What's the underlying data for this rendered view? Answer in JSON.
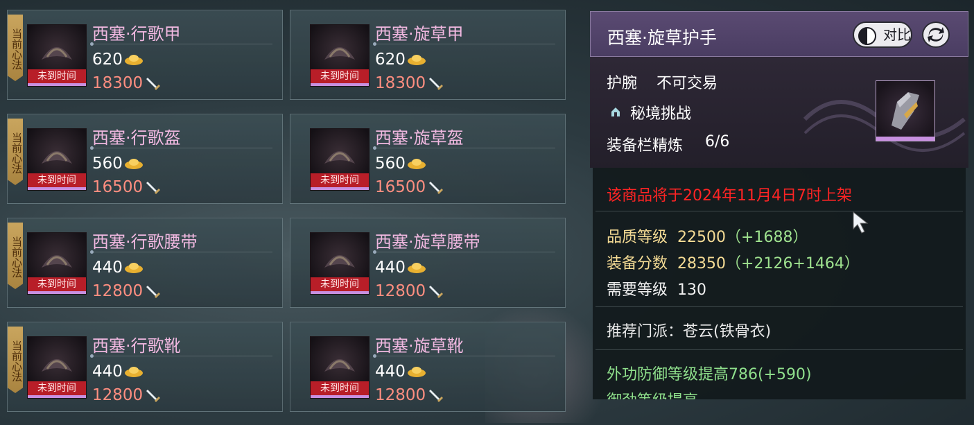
{
  "items": [
    {
      "badge": "当前心法",
      "name": "西塞·行歌甲",
      "price": "620",
      "cost": "18300",
      "timer": "未到时间"
    },
    {
      "badge": "",
      "name": "西塞·旋草甲",
      "price": "620",
      "cost": "18300",
      "timer": "未到时间"
    },
    {
      "badge": "当前心法",
      "name": "西塞·行歌盔",
      "price": "560",
      "cost": "16500",
      "timer": "未到时间"
    },
    {
      "badge": "",
      "name": "西塞·旋草盔",
      "price": "560",
      "cost": "16500",
      "timer": "未到时间"
    },
    {
      "badge": "当前心法",
      "name": "西塞·行歌腰带",
      "price": "440",
      "cost": "12800",
      "timer": "未到时间"
    },
    {
      "badge": "",
      "name": "西塞·旋草腰带",
      "price": "440",
      "cost": "12800",
      "timer": "未到时间"
    },
    {
      "badge": "当前心法",
      "name": "西塞·行歌靴",
      "price": "440",
      "cost": "12800",
      "timer": "未到时间"
    },
    {
      "badge": "",
      "name": "西塞·旋草靴",
      "price": "440",
      "cost": "12800",
      "timer": "未到时间"
    }
  ],
  "detail": {
    "title": "西塞·旋草护手",
    "compare_label": "对比",
    "slot": "护腕",
    "trade": "不可交易",
    "source": "秘境挑战",
    "refine_label": "装备栏精炼",
    "refine_value": "6/6",
    "notice": "该商品将于2024年11月4日7时上架",
    "quality_label": "品质等级",
    "quality_value": "22500",
    "quality_bonus": "（+1688）",
    "score_label": "装备分数",
    "score_value": "28350",
    "score_bonus": "（+2126+1464）",
    "level_label": "需要等级",
    "level_value": "130",
    "recommend": "推荐门派：苍云(铁骨衣)",
    "attr1": "外功防御等级提高786",
    "attr1_bonus": "(+590)",
    "attr2_partial": "御劲等级提高"
  },
  "colors": {
    "name": "#f0b8e0",
    "cost": "#ff8e80",
    "timer_bg": "#b81e28",
    "badge": "#c9a55e",
    "notice": "#ff2424",
    "stat": "#f6dc95",
    "bonus": "#9fe28f"
  },
  "icons": {
    "price": "gold-ingot-icon",
    "cost": "sword-icon",
    "compare": "contrast-icon",
    "share": "share-icon",
    "source": "dungeon-icon"
  }
}
